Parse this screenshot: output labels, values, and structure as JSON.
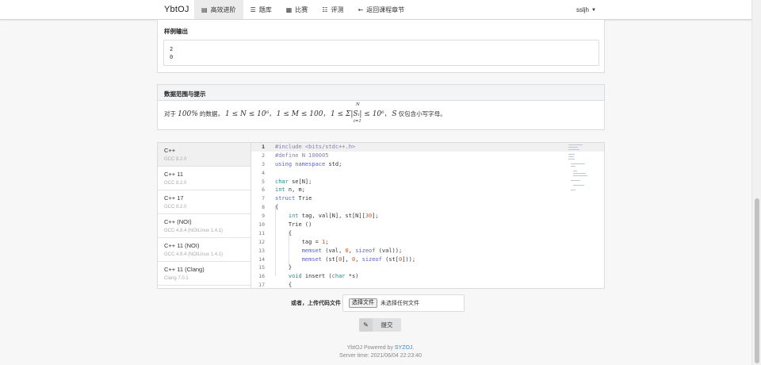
{
  "nav": {
    "brand": "YbtOJ",
    "items": [
      {
        "icon": "book-icon",
        "glyph": "▤",
        "label": "高效进阶",
        "active": true
      },
      {
        "icon": "list-icon",
        "glyph": "☰",
        "label": "题库",
        "active": false
      },
      {
        "icon": "calendar-icon",
        "glyph": "▦",
        "label": "比赛",
        "active": false
      },
      {
        "icon": "tasks-icon",
        "glyph": "☷",
        "label": "评测",
        "active": false
      },
      {
        "icon": "arrow-left-icon",
        "glyph": "←",
        "label": "返回课程章节",
        "active": false
      }
    ],
    "user": "ssljh"
  },
  "sample_output": {
    "title": "样例输出",
    "content": "2\n0"
  },
  "hints": {
    "title": "数据范围与提示",
    "prefix": "对于",
    "percent": "100%",
    "mid": "的数据，",
    "cond1": "1 ≤ N ≤ 10⁶",
    "cond2": "1 ≤ M ≤ 100",
    "cond3": "1 ≤ Σ|Sᵢ| ≤ 10⁶",
    "sum_upper": "N",
    "sum_lower": "i=1",
    "var_s": "S",
    "suffix": "仅包含小写字母。"
  },
  "languages": [
    {
      "name": "C++",
      "version": "GCC 8.2.0",
      "active": true
    },
    {
      "name": "C++ 11",
      "version": "GCC 8.2.0",
      "active": false
    },
    {
      "name": "C++ 17",
      "version": "GCC 8.2.0",
      "active": false
    },
    {
      "name": "C++ (NOI)",
      "version": "GCC 4.8.4 (NOILinux 1.4.1)",
      "active": false
    },
    {
      "name": "C++ 11 (NOI)",
      "version": "GCC 4.8.4 (NOILinux 1.4.1)",
      "active": false
    },
    {
      "name": "C++ 11 (Clang)",
      "version": "Clang 7.0.1",
      "active": false
    }
  ],
  "code": {
    "current_line": 1,
    "lines": [
      "#include <bits/stdc++.h>",
      "#define N 100005",
      "using namespace std;",
      "",
      "char se[N];",
      "int n, m;",
      "struct Trie",
      "{",
      "    int tag, val[N], st[N][30];",
      "    Trie ()",
      "    {",
      "        tag = 1;",
      "        memset (val, 0, sizeof (val));",
      "        memset (st[0], 0, sizeof (st[0]));",
      "    }",
      "    void insert (char *s)",
      "    {"
    ]
  },
  "upload": {
    "label": "或者，上传代码文件",
    "button": "选择文件",
    "status": "未选择任何文件"
  },
  "submit": {
    "label": "提交"
  },
  "footer": {
    "powered_prefix": "YbtOJ Powered by ",
    "powered_link": "SYZOJ",
    "powered_suffix": ".",
    "server_time": "Server time: 2021/06/04 22:23:40"
  }
}
